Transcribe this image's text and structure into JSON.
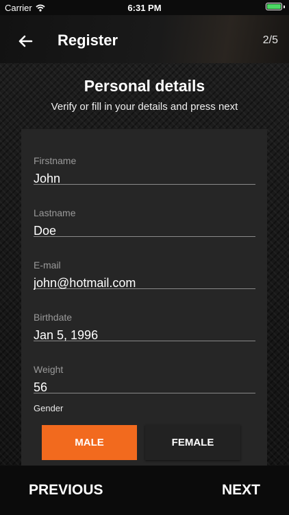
{
  "status_bar": {
    "carrier": "Carrier",
    "time": "6:31 PM",
    "battery_color": "#4cd964",
    "wifi_icon": "wifi-icon",
    "battery_icon": "battery-icon"
  },
  "header": {
    "title": "Register",
    "step": "2/5",
    "back_icon": "arrow-left-icon"
  },
  "section": {
    "title": "Personal details",
    "subtitle": "Verify or fill in your details and press next"
  },
  "form": {
    "fields": [
      {
        "label": "Firstname",
        "value": "John"
      },
      {
        "label": "Lastname",
        "value": "Doe"
      },
      {
        "label": "E-mail",
        "value": "john@hotmail.com"
      },
      {
        "label": "Birthdate",
        "value": "Jan 5, 1996"
      },
      {
        "label": "Weight",
        "value": "56"
      }
    ],
    "gender": {
      "label": "Gender",
      "options": [
        "MALE",
        "FEMALE"
      ],
      "selected": "MALE"
    }
  },
  "footer": {
    "previous_label": "PREVIOUS",
    "next_label": "NEXT"
  },
  "colors": {
    "accent": "#f26a1e",
    "background": "#161616",
    "card": "#262626"
  }
}
